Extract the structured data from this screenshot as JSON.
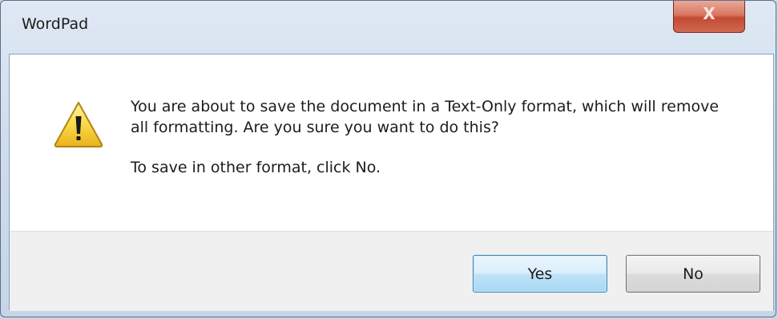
{
  "window": {
    "title": "WordPad",
    "close_label": "X",
    "close_color": "#c24a32"
  },
  "message": {
    "icon": "warning-icon",
    "line1": "You are about to save the document in a Text-Only format, which will remove all formatting. Are you sure you want to do this?",
    "line2": "To save in other format, click No."
  },
  "buttons": {
    "yes_label": "Yes",
    "no_label": "No"
  }
}
